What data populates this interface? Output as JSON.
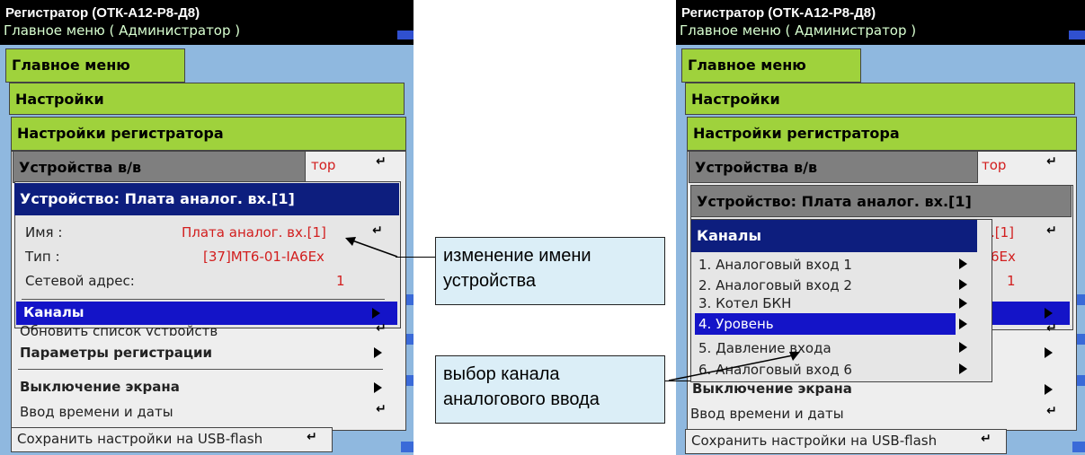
{
  "title": "Регистратор (ОТК-А12-Р8-Д8)",
  "subtitle": "Главное меню ( Администратор )",
  "menus": {
    "main": "Главное меню",
    "settings": "Настройки",
    "reg_settings": "Настройки регистратора",
    "io_devices": "Устройства в/в",
    "partial_top": "тор",
    "device_dialog": "Устройство: Плата аналог. вх.[1]"
  },
  "device": {
    "name_label": "Имя :",
    "name_value": "Плата аналог. вх.[1]",
    "type_label": "Тип :",
    "type_value": "[37]МТ6-01-IA6Ex",
    "net_label": "Сетевой адрес:",
    "net_value": "1",
    "channels": "Каналы"
  },
  "settings_items": {
    "update_list": "Обновить список устройств",
    "reg_params": "Параметры регистрации",
    "screen_off": "Выключение экрана",
    "datetime": "Ввод времени и даты",
    "save_usb": "Сохранить настройки на USB-flash"
  },
  "channels_menu": {
    "title": "Каналы",
    "items": [
      "1. Аналоговый вход 1",
      "2. Аналоговый вход 2",
      "3. Котел БКН",
      "4. Уровень",
      "5. Давление входа",
      "6. Аналоговый вход 6"
    ]
  },
  "right_partials": {
    "name_tail": ".[1]",
    "type_tail": "6Ex",
    "net_tail": "1"
  },
  "callouts": {
    "rename": "изменение имени устройства",
    "select_channel": "выбор канала аналогового ввода"
  },
  "colors": {
    "green_header": "#9fd23c",
    "navy_header": "#0d1e7e",
    "selection": "#1414c8",
    "background": "#8fb8df"
  }
}
